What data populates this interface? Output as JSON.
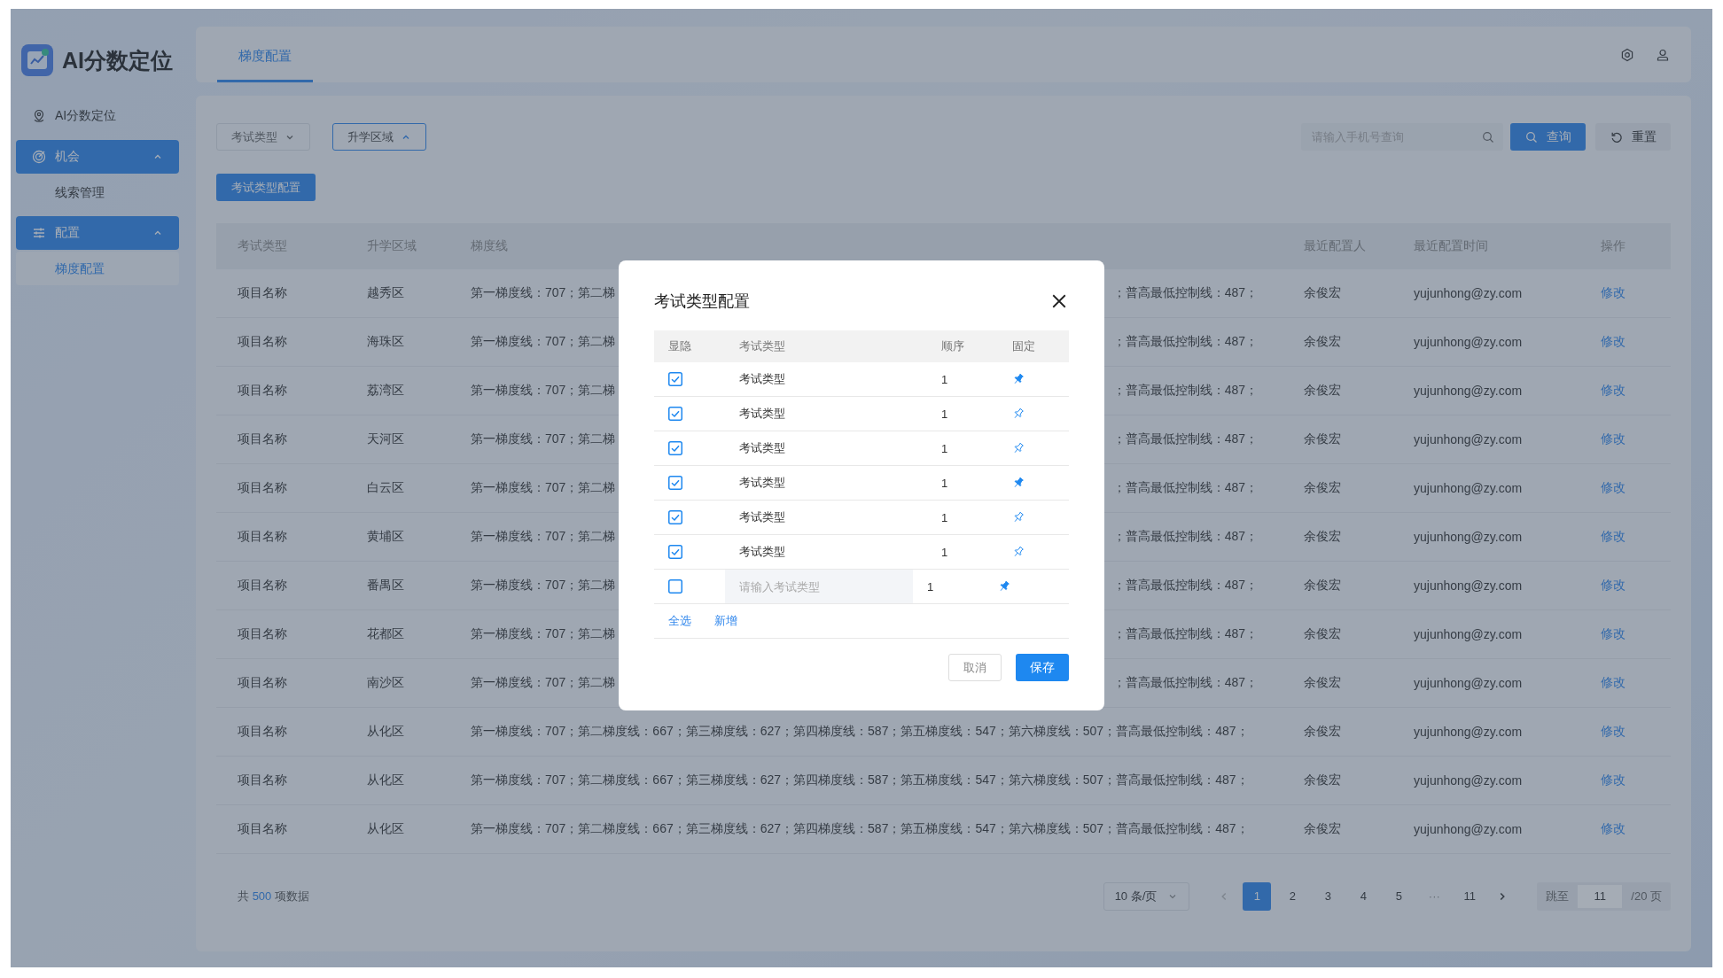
{
  "app": {
    "logo_text": "AI分数定位"
  },
  "sidebar": {
    "items": [
      {
        "kind": "link",
        "label": "AI分数定位"
      },
      {
        "kind": "group",
        "label": "机会",
        "expanded": true,
        "children": [
          {
            "label": "线索管理",
            "selected": false
          }
        ]
      },
      {
        "kind": "group",
        "label": "配置",
        "expanded": true,
        "children": [
          {
            "label": "梯度配置",
            "selected": true
          }
        ]
      }
    ]
  },
  "header": {
    "tabs": [
      {
        "label": "梯度配置",
        "selected": true
      }
    ]
  },
  "filters": [
    {
      "label": "考试类型",
      "open": false
    },
    {
      "label": "升学区域",
      "open": true
    }
  ],
  "search": {
    "placeholder": "请输入手机号查询"
  },
  "query_button": "查询",
  "reset_button": "重置",
  "config_button": "考试类型配置",
  "table": {
    "columns": [
      "考试类型",
      "升学区域",
      "梯度线",
      "最近配置人",
      "最近配置时间",
      "操作"
    ],
    "rows": [
      {
        "exam_type": "项目名称",
        "district": "越秀区",
        "gradient_start": "第一梯度线：707；第二梯",
        "gradient_end": "；普高最低控制线：487；",
        "configurer": "余俊宏",
        "config_time": "yujunhong@zy.com",
        "action": "修改"
      },
      {
        "exam_type": "项目名称",
        "district": "海珠区",
        "gradient_start": "第一梯度线：707；第二梯",
        "gradient_end": "；普高最低控制线：487；",
        "configurer": "余俊宏",
        "config_time": "yujunhong@zy.com",
        "action": "修改"
      },
      {
        "exam_type": "项目名称",
        "district": "荔湾区",
        "gradient_start": "第一梯度线：707；第二梯",
        "gradient_end": "；普高最低控制线：487；",
        "configurer": "余俊宏",
        "config_time": "yujunhong@zy.com",
        "action": "修改"
      },
      {
        "exam_type": "项目名称",
        "district": "天河区",
        "gradient_start": "第一梯度线：707；第二梯",
        "gradient_end": "；普高最低控制线：487；",
        "configurer": "余俊宏",
        "config_time": "yujunhong@zy.com",
        "action": "修改"
      },
      {
        "exam_type": "项目名称",
        "district": "白云区",
        "gradient_start": "第一梯度线：707；第二梯",
        "gradient_end": "；普高最低控制线：487；",
        "configurer": "余俊宏",
        "config_time": "yujunhong@zy.com",
        "action": "修改"
      },
      {
        "exam_type": "项目名称",
        "district": "黄埔区",
        "gradient_start": "第一梯度线：707；第二梯",
        "gradient_end": "；普高最低控制线：487；",
        "configurer": "余俊宏",
        "config_time": "yujunhong@zy.com",
        "action": "修改"
      },
      {
        "exam_type": "项目名称",
        "district": "番禺区",
        "gradient_start": "第一梯度线：707；第二梯",
        "gradient_end": "；普高最低控制线：487；",
        "configurer": "余俊宏",
        "config_time": "yujunhong@zy.com",
        "action": "修改"
      },
      {
        "exam_type": "项目名称",
        "district": "花都区",
        "gradient_start": "第一梯度线：707；第二梯",
        "gradient_end": "；普高最低控制线：487；",
        "configurer": "余俊宏",
        "config_time": "yujunhong@zy.com",
        "action": "修改"
      },
      {
        "exam_type": "项目名称",
        "district": "南沙区",
        "gradient_start": "第一梯度线：707；第二梯",
        "gradient_end": "；普高最低控制线：487；",
        "configurer": "余俊宏",
        "config_time": "yujunhong@zy.com",
        "action": "修改"
      },
      {
        "exam_type": "项目名称",
        "district": "从化区",
        "gradient": "第一梯度线：707；第二梯度线：667；第三梯度线：627；第四梯度线：587；第五梯度线：547；第六梯度线：507；普高最低控制线：487；",
        "configurer": "余俊宏",
        "config_time": "yujunhong@zy.com",
        "action": "修改"
      },
      {
        "exam_type": "项目名称",
        "district": "从化区",
        "gradient": "第一梯度线：707；第二梯度线：667；第三梯度线：627；第四梯度线：587；第五梯度线：547；第六梯度线：507；普高最低控制线：487；",
        "configurer": "余俊宏",
        "config_time": "yujunhong@zy.com",
        "action": "修改"
      },
      {
        "exam_type": "项目名称",
        "district": "从化区",
        "gradient": "第一梯度线：707；第二梯度线：667；第三梯度线：627；第四梯度线：587；第五梯度线：547；第六梯度线：507；普高最低控制线：487；",
        "configurer": "余俊宏",
        "config_time": "yujunhong@zy.com",
        "action": "修改"
      }
    ]
  },
  "pagination": {
    "total_prefix": "共",
    "total": "500",
    "total_suffix": "项数据",
    "page_size": "10 条/页",
    "pages": [
      {
        "kind": "page",
        "label": "1",
        "selected": true
      },
      {
        "kind": "page",
        "label": "2",
        "selected": false
      },
      {
        "kind": "page",
        "label": "3",
        "selected": false
      },
      {
        "kind": "page",
        "label": "4",
        "selected": false
      },
      {
        "kind": "page",
        "label": "5",
        "selected": false
      },
      {
        "kind": "ellipsis",
        "label": "···"
      },
      {
        "kind": "page",
        "label": "11",
        "selected": false
      }
    ],
    "jump_label": "跳至",
    "jump_value": "11",
    "page_count": "/20 页"
  },
  "modal": {
    "title": "考试类型配置",
    "columns": [
      "显隐",
      "考试类型",
      "顺序",
      "固定"
    ],
    "rows": [
      {
        "kind": "text",
        "visible": true,
        "name": "考试类型",
        "order": "1",
        "pinned": true
      },
      {
        "kind": "text",
        "visible": true,
        "name": "考试类型",
        "order": "1",
        "pinned": false
      },
      {
        "kind": "text",
        "visible": true,
        "name": "考试类型",
        "order": "1",
        "pinned": false
      },
      {
        "kind": "text",
        "visible": true,
        "name": "考试类型",
        "order": "1",
        "pinned": true
      },
      {
        "kind": "text",
        "visible": true,
        "name": "考试类型",
        "order": "1",
        "pinned": false
      },
      {
        "kind": "text",
        "visible": true,
        "name": "考试类型",
        "order": "1",
        "pinned": false
      },
      {
        "kind": "input",
        "visible": false,
        "placeholder": "请输入考试类型",
        "order": "1",
        "pinned": true
      }
    ],
    "links": [
      "全选",
      "新增"
    ],
    "cancel": "取消",
    "save": "保存"
  }
}
